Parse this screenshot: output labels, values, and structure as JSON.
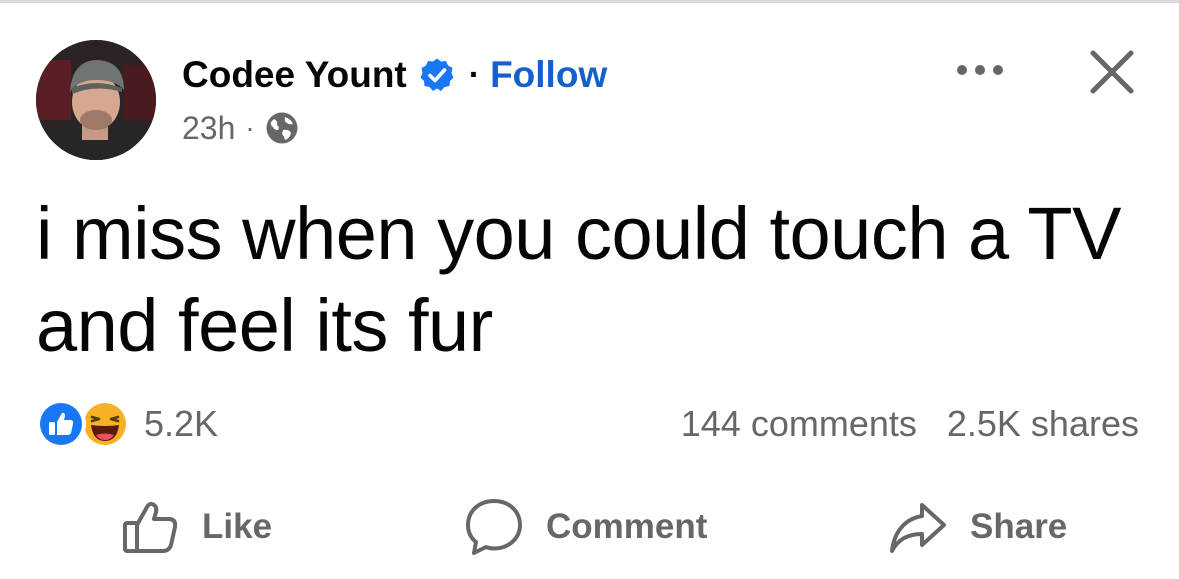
{
  "author": {
    "name": "Codee Yount",
    "follow_label": "Follow",
    "separator": "·",
    "timestamp": "23h",
    "meta_separator": "·"
  },
  "post": {
    "text": "i miss when you could touch a TV and feel its fur"
  },
  "engagement": {
    "reaction_count": "5.2K",
    "comments": "144 comments",
    "shares": "2.5K shares",
    "reactions": [
      "like-reaction-icon",
      "haha-reaction-icon"
    ]
  },
  "actions": {
    "like_label": "Like",
    "comment_label": "Comment",
    "share_label": "Share"
  },
  "colors": {
    "follow_blue": "#1461cc",
    "verified_blue": "#1877f2",
    "secondary_text": "#65676b",
    "primary_text": "#050505"
  }
}
